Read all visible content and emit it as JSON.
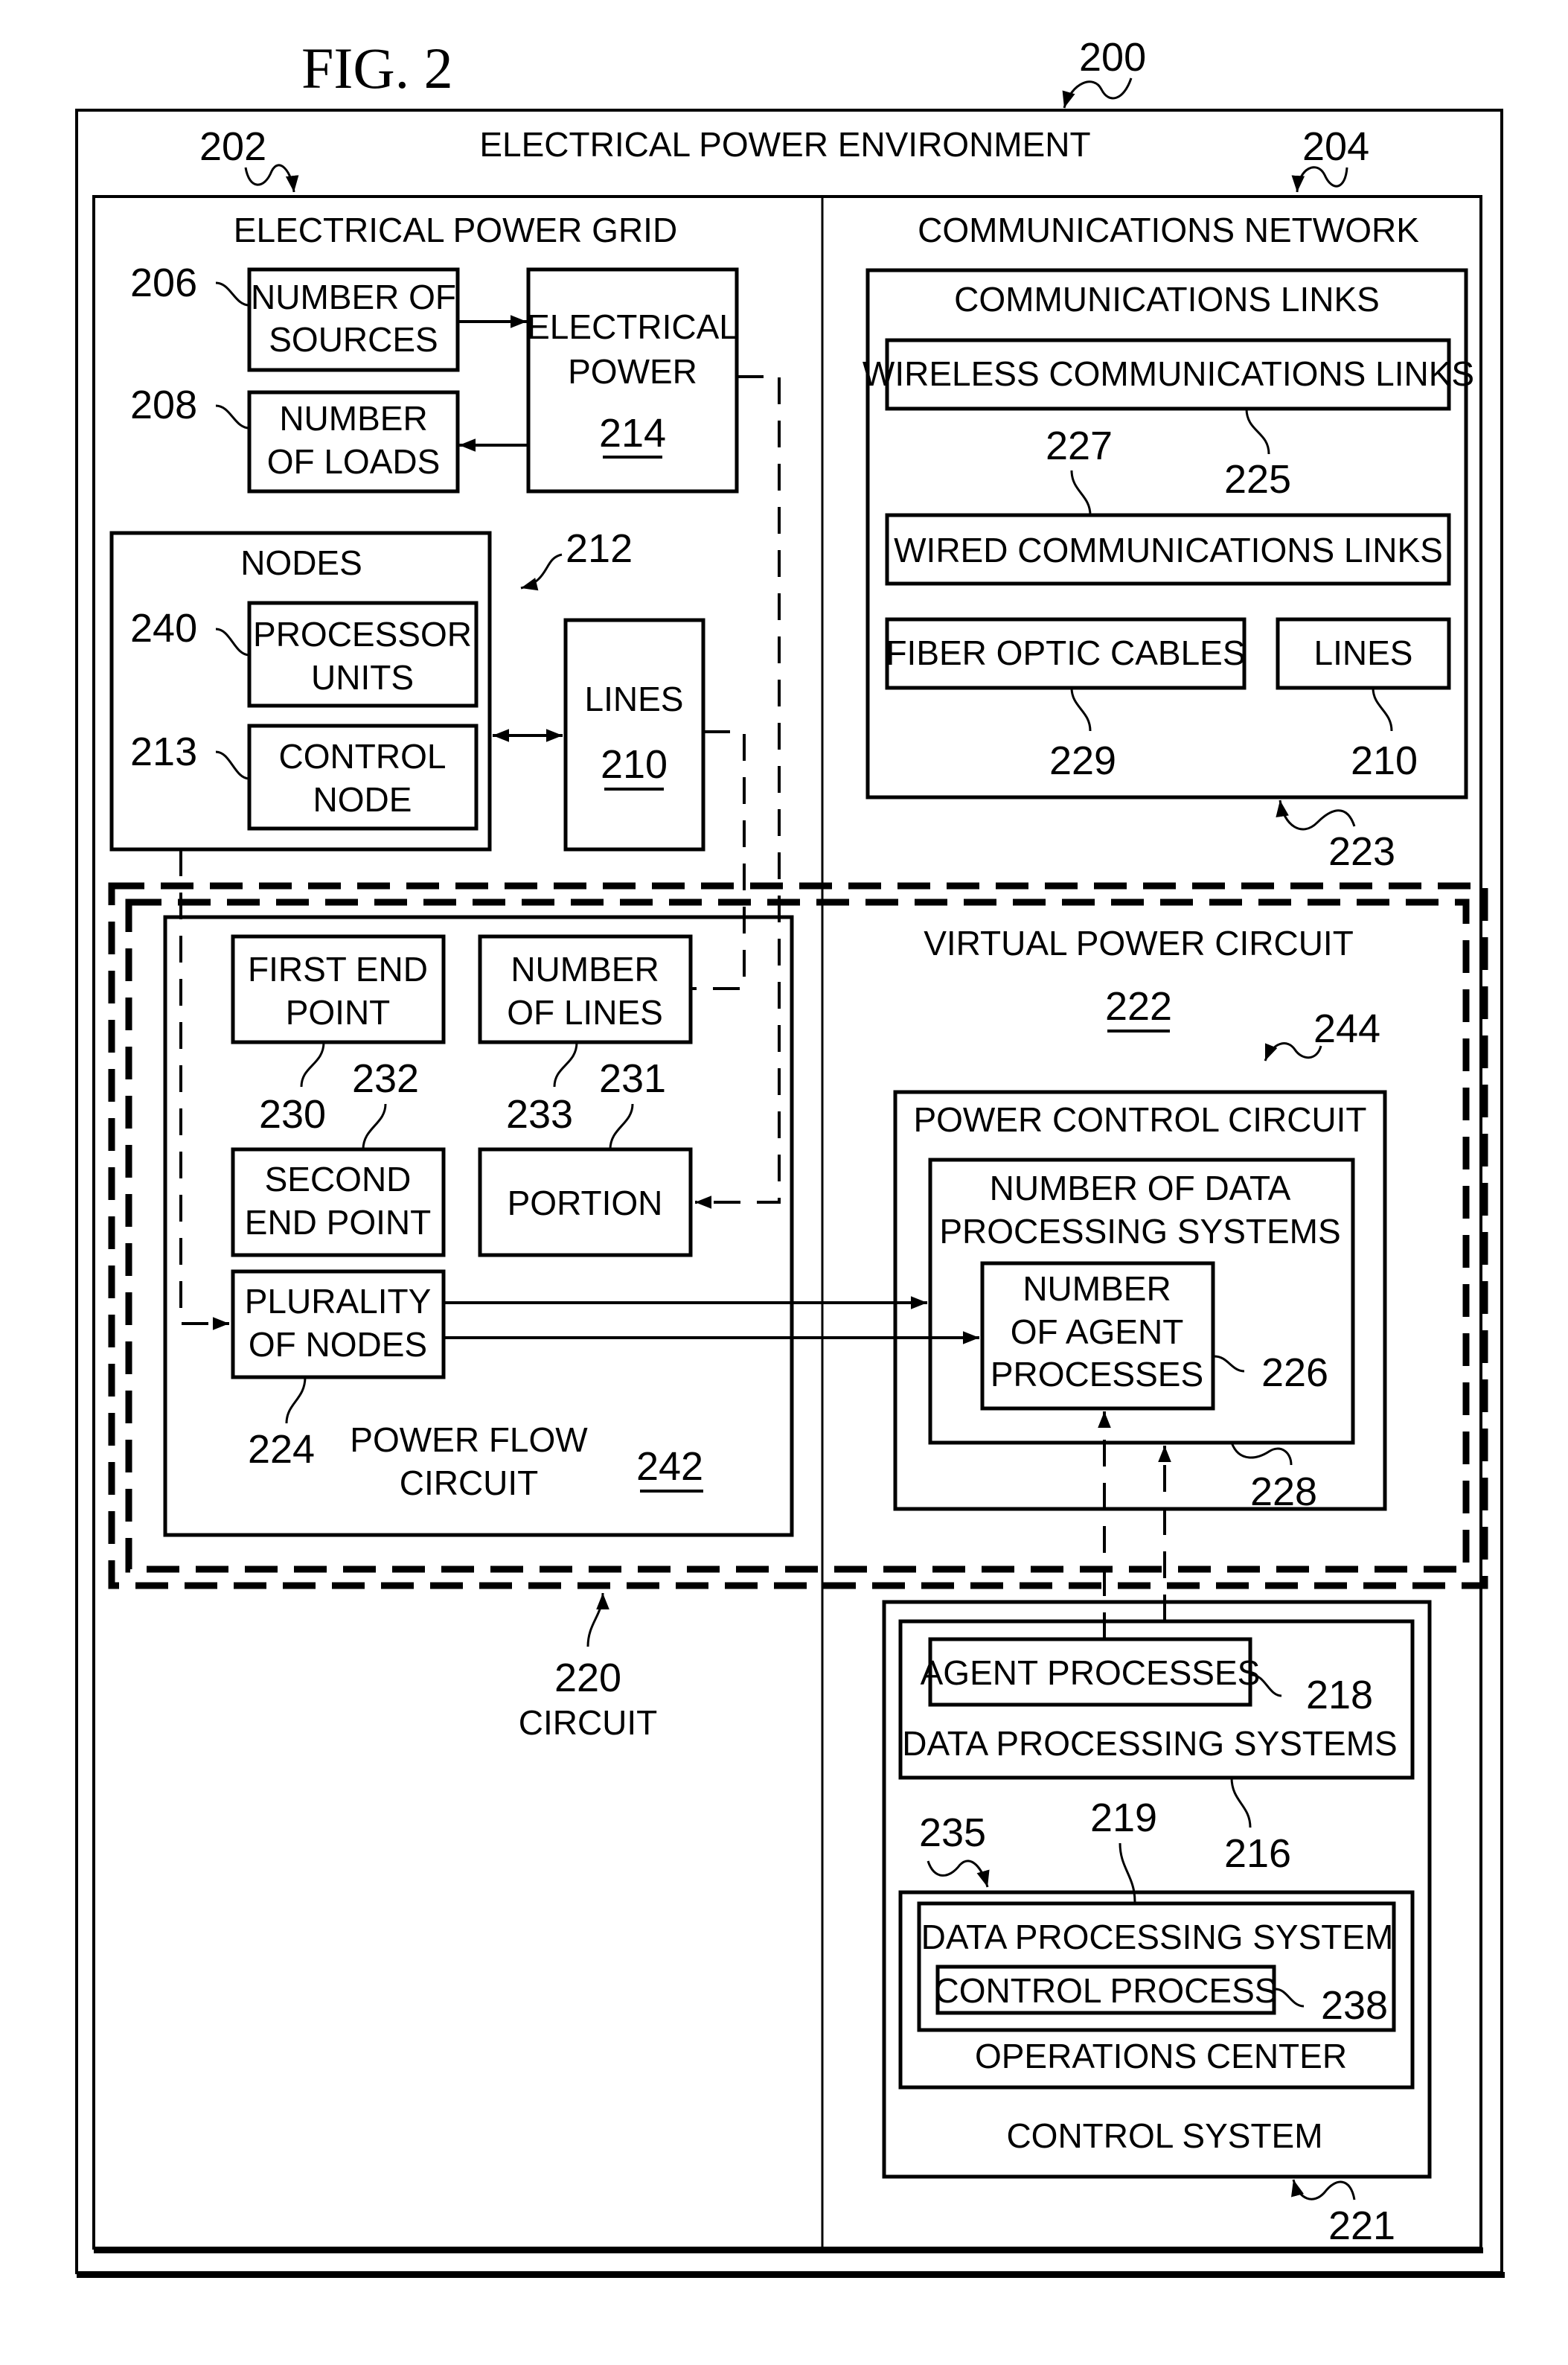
{
  "figure": {
    "title": "FIG. 2",
    "ref": "200"
  },
  "environment": {
    "label": "ELECTRICAL POWER ENVIRONMENT"
  },
  "grid": {
    "ref": "202",
    "label": "ELECTRICAL POWER GRID",
    "sources": {
      "ref": "206",
      "line1": "NUMBER OF",
      "line2": "SOURCES"
    },
    "loads": {
      "ref": "208",
      "line1": "NUMBER",
      "line2": "OF LOADS"
    },
    "power": {
      "line1": "ELECTRICAL",
      "line2": "POWER",
      "ref": "214"
    },
    "nodes": {
      "ref": "212",
      "label": "NODES",
      "processor": {
        "ref": "240",
        "line1": "PROCESSOR",
        "line2": "UNITS"
      },
      "control": {
        "ref": "213",
        "line1": "CONTROL",
        "line2": "NODE"
      }
    },
    "lines": {
      "label": "LINES",
      "ref": "210"
    }
  },
  "comms": {
    "ref": "204",
    "label": "COMMUNICATIONS NETWORK",
    "links": {
      "ref": "223",
      "label": "COMMUNICATIONS LINKS",
      "wireless": {
        "label": "WIRELESS COMMUNICATIONS LINKS",
        "ref": "225"
      },
      "wired": {
        "label": "WIRED COMMUNICATIONS LINKS",
        "ref": "227"
      },
      "fiber": {
        "label": "FIBER OPTIC CABLES",
        "ref": "229"
      },
      "lines": {
        "label": "LINES",
        "ref": "210"
      }
    }
  },
  "circuit": {
    "ref": "220",
    "label": "CIRCUIT",
    "power_flow": {
      "line1": "POWER FLOW",
      "line2": "CIRCUIT",
      "ref": "242",
      "first_end": {
        "line1": "FIRST END",
        "line2": "POINT",
        "ref": "230"
      },
      "num_lines": {
        "line1": "NUMBER",
        "line2": "OF LINES",
        "ref": "233"
      },
      "second_end": {
        "line1": "SECOND",
        "line2": "END POINT",
        "ref": "232"
      },
      "portion": {
        "label": "PORTION",
        "ref": "231"
      },
      "plurality": {
        "line1": "PLURALITY",
        "line2": "OF NODES",
        "ref": "224"
      }
    },
    "virtual": {
      "label": "VIRTUAL POWER CIRCUIT",
      "ref": "222",
      "power_control": {
        "ref": "244",
        "label": "POWER CONTROL CIRCUIT",
        "dps": {
          "line1": "NUMBER OF DATA",
          "line2": "PROCESSING SYSTEMS",
          "ref": "228"
        },
        "agents": {
          "line1": "NUMBER",
          "line2": "OF AGENT",
          "line3": "PROCESSES",
          "ref": "226"
        }
      }
    }
  },
  "control_system": {
    "ref": "221",
    "label": "CONTROL SYSTEM",
    "dps": {
      "ref": "216",
      "label": "DATA PROCESSING SYSTEMS",
      "agent": {
        "label": "AGENT PROCESSES",
        "ref": "218"
      }
    },
    "ops": {
      "ref": "235",
      "label": "OPERATIONS CENTER",
      "dps": {
        "ref": "219",
        "label": "DATA PROCESSING SYSTEM",
        "control": {
          "label": "CONTROL PROCESS",
          "ref": "238"
        }
      }
    }
  }
}
